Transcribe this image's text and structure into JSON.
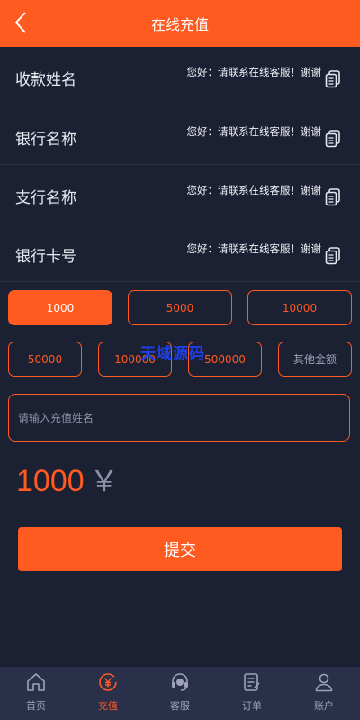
{
  "header": {
    "title": "在线充值",
    "back_icon": "chevron-left-icon"
  },
  "info": [
    {
      "label": "收款姓名",
      "value": "您好：请联系在线客服！谢谢"
    },
    {
      "label": "银行名称",
      "value": "您好：请联系在线客服！谢谢"
    },
    {
      "label": "支行名称",
      "value": "您好：请联系在线客服！谢谢"
    },
    {
      "label": "银行卡号",
      "value": "您好：请联系在线客服！谢谢"
    }
  ],
  "amounts": [
    "1000",
    "5000",
    "10000",
    "50000",
    "100000",
    "500000"
  ],
  "selected_amount": "1000",
  "other_amount_label": "其他金额",
  "watermark": "天域源码",
  "name_input": {
    "placeholder": "请输入充值姓名",
    "value": ""
  },
  "display": {
    "amount": "1000",
    "currency": "￥"
  },
  "submit_label": "提交",
  "tabs": [
    {
      "label": "首页",
      "icon": "home-icon"
    },
    {
      "label": "充值",
      "icon": "yuan-icon",
      "active": true
    },
    {
      "label": "客服",
      "icon": "headset-icon"
    },
    {
      "label": "订单",
      "icon": "order-icon"
    },
    {
      "label": "账户",
      "icon": "user-icon"
    }
  ],
  "colors": {
    "accent": "#ff5a1f",
    "background": "#1c2033",
    "tabbar": "#2a2f4a"
  }
}
